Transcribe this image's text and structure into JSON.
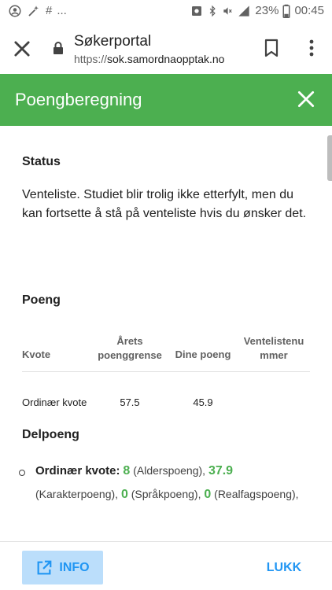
{
  "status_bar": {
    "left_extra": "...",
    "battery": "23%",
    "time": "00:45",
    "icons": [
      "account-circle-icon",
      "wand-icon",
      "hashtag-icon",
      "photo-icon",
      "bluetooth-icon",
      "mute-icon",
      "signal-icon",
      "battery-icon"
    ]
  },
  "browser": {
    "title": "Søkerportal",
    "url_scheme": "https://",
    "url_host": "sok.samordnaopptak.no"
  },
  "dialog": {
    "title": "Poengberegning"
  },
  "status": {
    "heading": "Status",
    "text": "Venteliste. Studiet blir trolig ikke etterfylt, men du kan fortsette å stå på venteliste hvis du ønsker det."
  },
  "poeng": {
    "heading": "Poeng",
    "columns": [
      "Kvote",
      "Årets poenggrense",
      "Dine poeng",
      "Ventelistenu mmer"
    ],
    "rows": [
      [
        "Ordinær kvote",
        "57.5",
        "45.9",
        ""
      ]
    ]
  },
  "delpoeng": {
    "heading": "Delpoeng",
    "label": "Ordinær kvote:",
    "v1": "8",
    "t1": " (Alderspoeng), ",
    "v2": "37.9",
    "t2": "(Karakterpoeng), ",
    "v3": "0",
    "t3": " (Språkpoeng), ",
    "v4": "0",
    "t4": " (Realfagspoeng),"
  },
  "footer": {
    "info_label": "INFO",
    "close_label": "LUKK"
  },
  "colors": {
    "header_green": "#4caf50",
    "accent_blue": "#2196f3",
    "info_bg": "#bbdefb"
  }
}
